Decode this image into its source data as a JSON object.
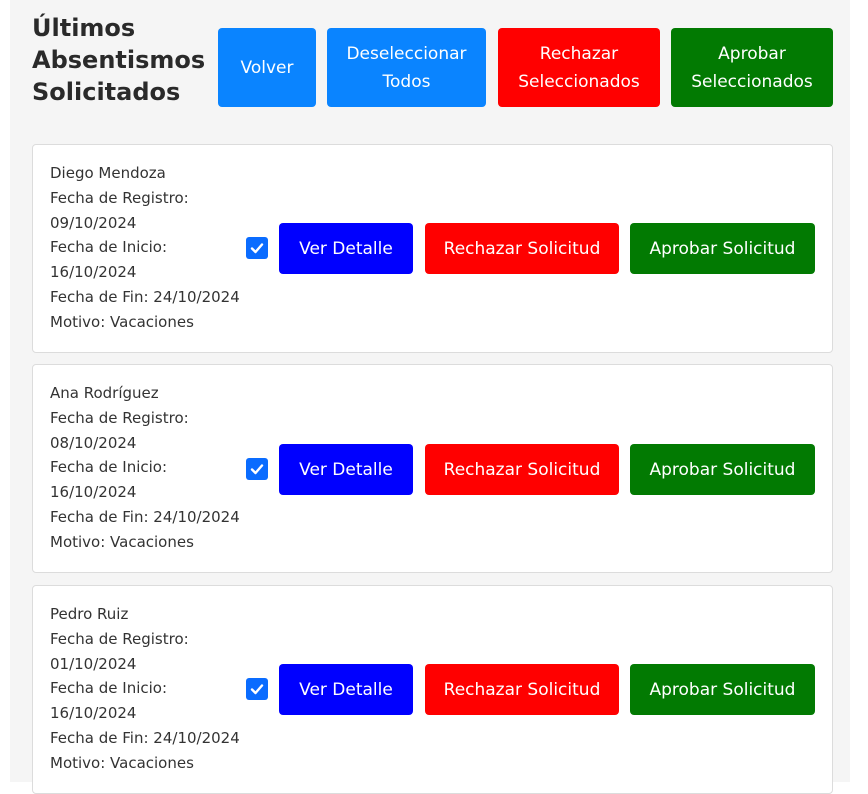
{
  "header": {
    "title": "Últimos Absentismos Solicitados",
    "buttons": {
      "back": "Volver",
      "deselect_all": "Deseleccionar Todos",
      "reject_selected": "Rechazar Seleccionados",
      "approve_selected": "Aprobar Seleccionados"
    }
  },
  "requests": [
    {
      "name": "Diego Mendoza",
      "registration": "Fecha de Registro: 09/10/2024",
      "start": "Fecha de Inicio: 16/10/2024",
      "end": "Fecha de Fin: 24/10/2024",
      "reason": "Motivo: Vacaciones",
      "checked": true,
      "detail_label": "Ver Detalle",
      "reject_label": "Rechazar Solicitud",
      "approve_label": "Aprobar Solicitud"
    },
    {
      "name": "Ana Rodríguez",
      "registration": "Fecha de Registro: 08/10/2024",
      "start": "Fecha de Inicio: 16/10/2024",
      "end": "Fecha de Fin: 24/10/2024",
      "reason": "Motivo: Vacaciones",
      "checked": true,
      "detail_label": "Ver Detalle",
      "reject_label": "Rechazar Solicitud",
      "approve_label": "Aprobar Solicitud"
    },
    {
      "name": "Pedro Ruiz",
      "registration": "Fecha de Registro: 01/10/2024",
      "start": "Fecha de Inicio: 16/10/2024",
      "end": "Fecha de Fin: 24/10/2024",
      "reason": "Motivo: Vacaciones",
      "checked": true,
      "detail_label": "Ver Detalle",
      "reject_label": "Rechazar Solicitud",
      "approve_label": "Aprobar Solicitud"
    }
  ],
  "colors": {
    "primary_blue": "#0a84ff",
    "detail_blue": "#0000ff",
    "reject_red": "#ff0000",
    "approve_green": "#027a02"
  }
}
